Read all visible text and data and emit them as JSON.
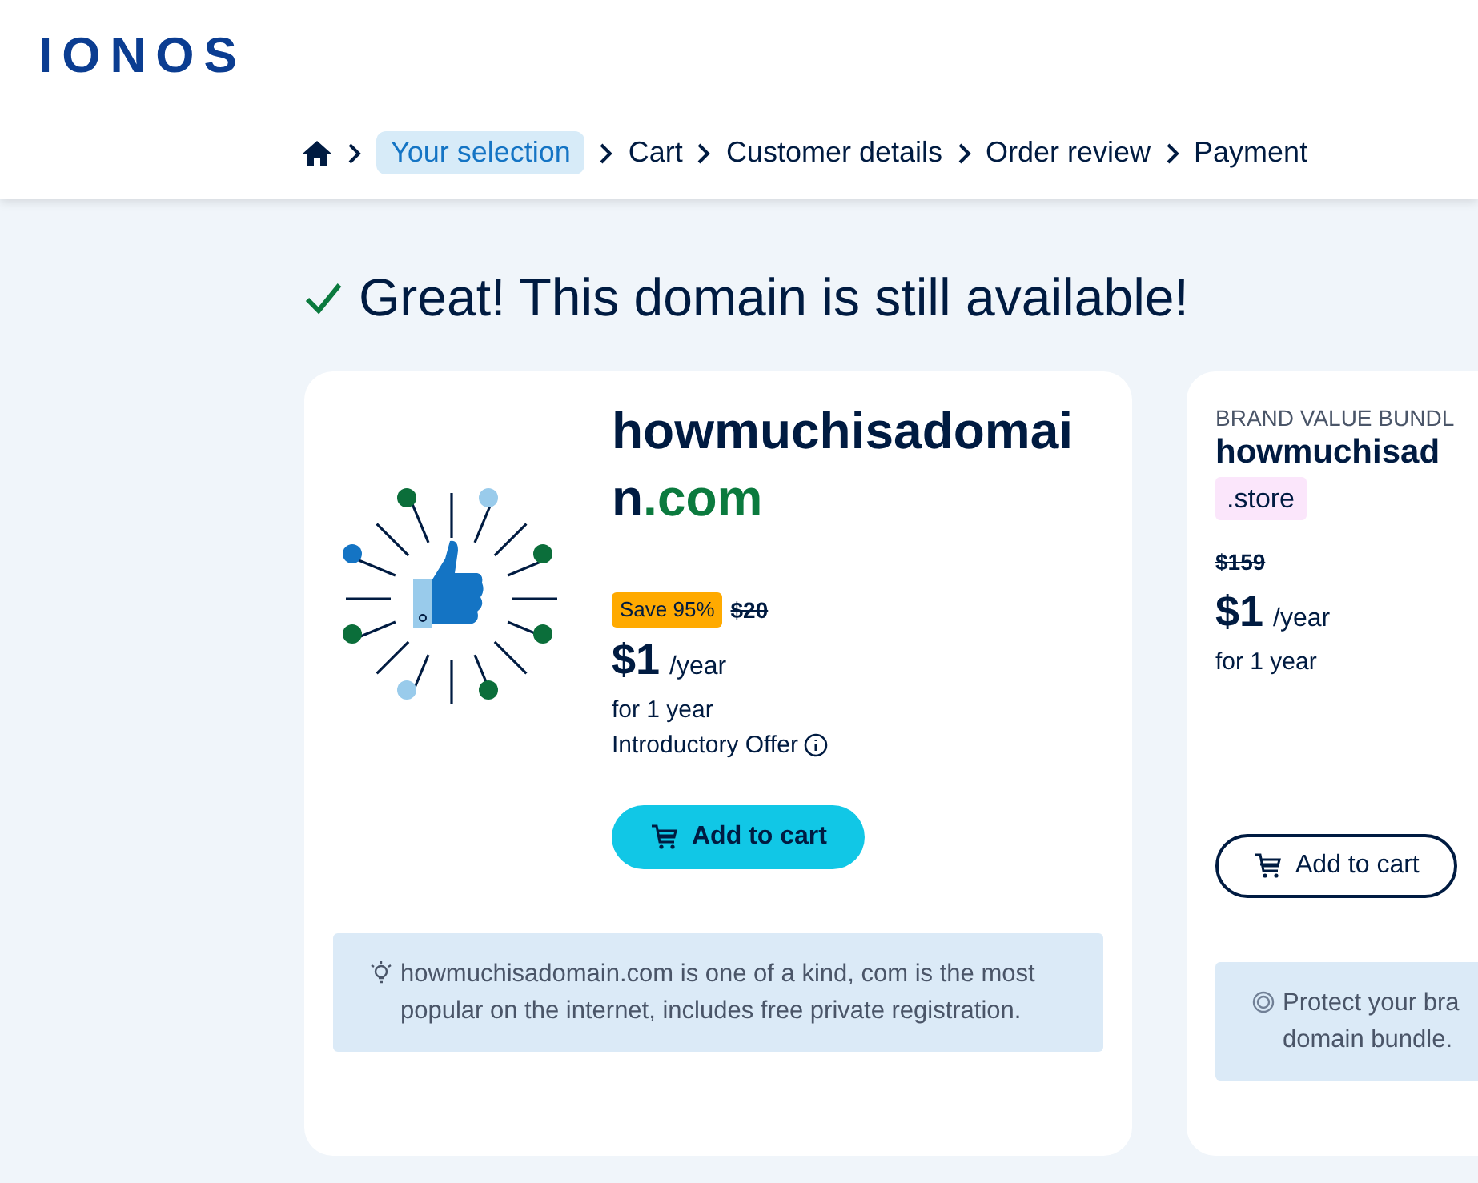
{
  "header": {
    "logo": "IONOS"
  },
  "breadcrumb": [
    {
      "kind": "home",
      "selected": false
    },
    {
      "label": "Your selection",
      "selected": true
    },
    {
      "label": "Cart",
      "selected": false
    },
    {
      "label": "Customer details",
      "selected": false
    },
    {
      "label": "Order review",
      "selected": false
    },
    {
      "label": "Payment",
      "selected": false
    }
  ],
  "headline": "Great! This domain is still available!",
  "cards": [
    {
      "kind": "primary",
      "name": "howmuchisadomain",
      "tld": ".com",
      "badge": "Save 95%",
      "old_price": "$20",
      "price": "$1",
      "period": "/year",
      "term": "for 1 year",
      "offer": "Introductory Offer",
      "button": "Add to cart",
      "note": "howmuchisadomain.com is one of a kind, com is the most popular on the internet, includes free private registration."
    },
    {
      "kind": "bundle",
      "eyebrow": "BRAND VALUE BUNDL",
      "name": "howmuchisad",
      "tld": ".store",
      "old_price": "$159",
      "price": "$1",
      "period": "/year",
      "term": "for 1 year",
      "button": "Add to cart",
      "note": "Protect your bra domain bundle."
    }
  ]
}
